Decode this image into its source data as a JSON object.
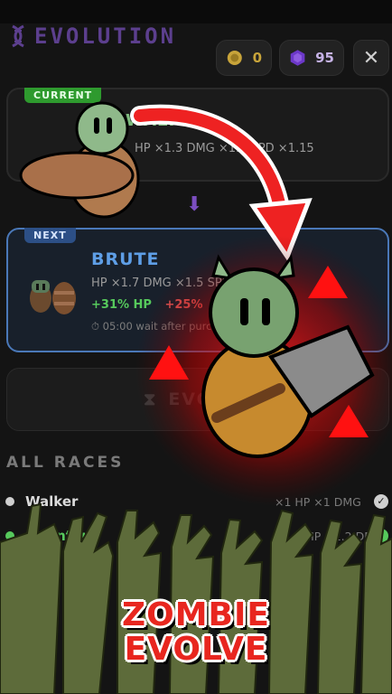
{
  "header": {
    "title": "EVOLUTION",
    "coins": "0",
    "gems": "95",
    "close": "✕"
  },
  "current": {
    "tag": "CURRENT",
    "name": "WALKER",
    "stats": "HP ×1.3  DMG ×1.2  SPD ×1.15"
  },
  "next": {
    "tag": "NEXT",
    "name": "BRUTE",
    "stats": "HP ×1.7  DMG ×1.5  SPD ×1.10",
    "bonus_hp": "+31% HP",
    "bonus_dmg": "+25%",
    "wait": "⏱ 05:00 wait after purchase"
  },
  "evolve_button": "EVOLVE",
  "races_title": "ALL RACES",
  "races": [
    {
      "name": "Walker",
      "stats": "×1 HP  ×1 DMG"
    },
    {
      "name": "Sprinter",
      "stats": "×1.3 HP  ×1.2 DMG"
    }
  ],
  "promo": {
    "line1": "ZOMBIE",
    "line2": "EVOLVE"
  },
  "colors": {
    "title": "#5c3f8e",
    "accent_blue": "#4a78b8",
    "accent_green": "#56c95c",
    "promo_red": "#e8261f"
  }
}
